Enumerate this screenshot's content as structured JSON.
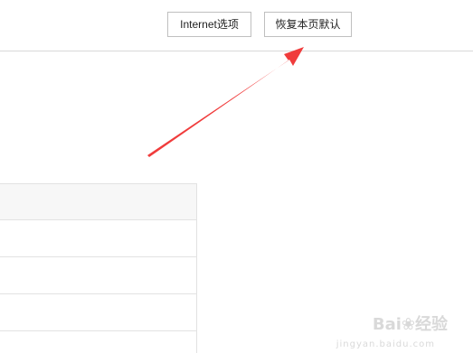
{
  "toolbar": {
    "internet_options_label": "Internet选项",
    "restore_defaults_label": "恢复本页默认"
  },
  "table": {
    "header": "",
    "rows": [
      "",
      "",
      "",
      ""
    ]
  },
  "watermark": {
    "brand": "Bai",
    "brand_suffix": "经验",
    "sub": "jingyan.baidu.com"
  },
  "colors": {
    "arrow": "#f03c3c",
    "border": "#d9d9d9",
    "header_bg": "#f7f7f7"
  },
  "icons": {
    "arrow": "red-arrow-pointer-icon",
    "paw": "baidu-paw-icon"
  }
}
